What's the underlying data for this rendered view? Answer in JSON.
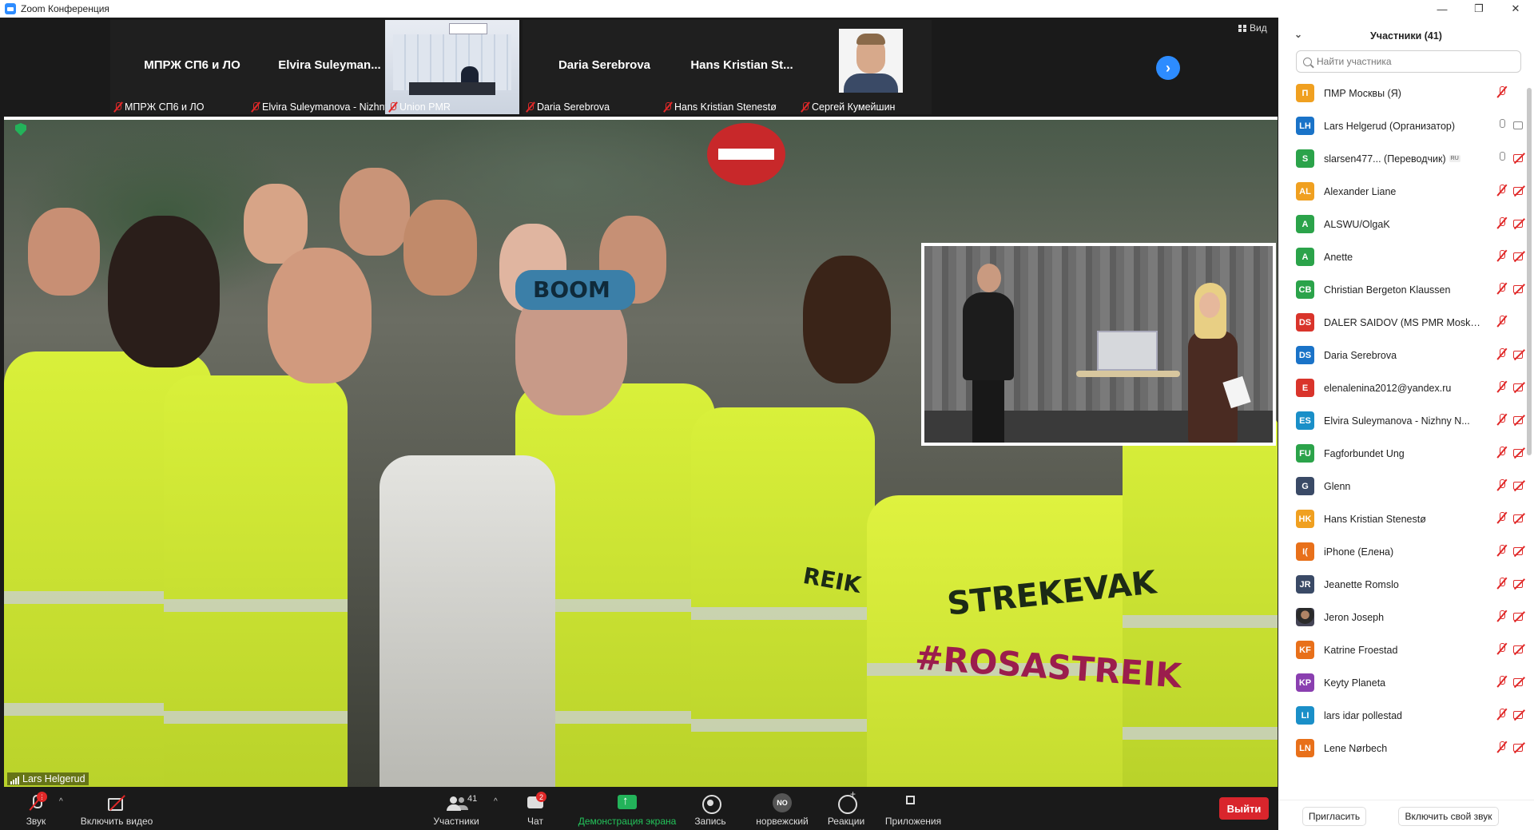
{
  "window": {
    "title": "Zoom Конференция",
    "controls": [
      "—",
      "❐",
      "✕"
    ]
  },
  "strip": {
    "tiles": [
      {
        "name": "МПРЖ СП6 и ЛО",
        "label": "МПРЖ СП6 и ЛО"
      },
      {
        "name": "Elvira  Suleyman...",
        "label": "Elvira Suleymanova - Nizhny ..."
      },
      {
        "name": "",
        "label": "Union PMR"
      },
      {
        "name": "Daria Serebrova",
        "label": "Daria Serebrova"
      },
      {
        "name": "Hans  Kristian  St...",
        "label": "Hans Kristian Stenestø"
      },
      {
        "name": "",
        "label": "Сергей Кумейшин"
      }
    ],
    "view_label": "Вид"
  },
  "main": {
    "speaker": "Lars Helgerud",
    "vest_text_1": "STREKEVAK",
    "vest_text_2": "#ROSASTREIK",
    "vest_text_3": "REIK",
    "cap_text": "BOOM"
  },
  "toolbar": {
    "audio": "Звук",
    "audio_badge": "!",
    "video": "Включить видео",
    "participants": "Участники",
    "participants_count": "41",
    "chat": "Чат",
    "chat_badge": "2",
    "share": "Демонстрация экрана",
    "record": "Запись",
    "language": "норвежский",
    "language_code": "NO",
    "reactions": "Реакции",
    "apps": "Приложения",
    "leave": "Выйти"
  },
  "panel": {
    "title": "Участники (41)",
    "search_placeholder": "Найти участника",
    "participants": [
      {
        "initials": "П",
        "name": "ПМР Москвы (Я)",
        "color": "#f0a020",
        "mic": "off",
        "cam": "none"
      },
      {
        "initials": "LH",
        "name": "Lars Helgerud (Организатор)",
        "color": "#1a73c8",
        "mic": "on",
        "cam": "on"
      },
      {
        "initials": "S",
        "name": "slarsen477...     (Переводчик)",
        "tag": "RU",
        "color": "#2ba34a",
        "mic": "on",
        "cam": "off"
      },
      {
        "initials": "AL",
        "name": "Alexander Liane",
        "color": "#f0a020",
        "mic": "off",
        "cam": "off"
      },
      {
        "initials": "A",
        "name": "ALSWU/OlgaK",
        "color": "#2ba34a",
        "mic": "off",
        "cam": "off"
      },
      {
        "initials": "A",
        "name": "Anette",
        "color": "#2ba34a",
        "mic": "off",
        "cam": "off"
      },
      {
        "initials": "CB",
        "name": "Christian Bergeton Klaussen",
        "color": "#2ba34a",
        "mic": "off",
        "cam": "off"
      },
      {
        "initials": "DS",
        "name": "DALER SAIDOV (MS PMR Moskva)",
        "color": "#d9342b",
        "mic": "off",
        "cam": "none"
      },
      {
        "initials": "DS",
        "name": "Daria Serebrova",
        "color": "#1a73c8",
        "mic": "off",
        "cam": "off"
      },
      {
        "initials": "E",
        "name": "elenalenina2012@yandex.ru",
        "color": "#d9342b",
        "mic": "off",
        "cam": "off"
      },
      {
        "initials": "ES",
        "name": "Elvira Suleymanova - Nizhny N...",
        "color": "#1a8fc8",
        "mic": "off",
        "cam": "off"
      },
      {
        "initials": "FU",
        "name": "Fagforbundet Ung",
        "color": "#2ba34a",
        "mic": "off",
        "cam": "off"
      },
      {
        "initials": "G",
        "name": "Glenn",
        "color": "#3a4a66",
        "mic": "off",
        "cam": "off"
      },
      {
        "initials": "HK",
        "name": "Hans Kristian Stenestø",
        "color": "#f0a020",
        "mic": "off",
        "cam": "off"
      },
      {
        "initials": "I(",
        "name": "iPhone (Елена)",
        "color": "#e8701a",
        "mic": "off",
        "cam": "off"
      },
      {
        "initials": "JR",
        "name": "Jeanette Romslo",
        "color": "#3a4a66",
        "mic": "off",
        "cam": "off"
      },
      {
        "initials": "",
        "name": "Jeron Joseph",
        "color": "#6b5a4a",
        "mic": "off",
        "cam": "off"
      },
      {
        "initials": "KF",
        "name": "Katrine Froestad",
        "color": "#e8701a",
        "mic": "off",
        "cam": "off"
      },
      {
        "initials": "KP",
        "name": "Keyty Planeta",
        "color": "#8a3fb0",
        "mic": "off",
        "cam": "off"
      },
      {
        "initials": "LI",
        "name": "lars idar pollestad",
        "color": "#1a8fc8",
        "mic": "off",
        "cam": "off"
      },
      {
        "initials": "LN",
        "name": "Lene Nørbech",
        "color": "#e8701a",
        "mic": "off",
        "cam": "off"
      }
    ],
    "invite": "Пригласить",
    "unmute": "Включить свой звук"
  }
}
